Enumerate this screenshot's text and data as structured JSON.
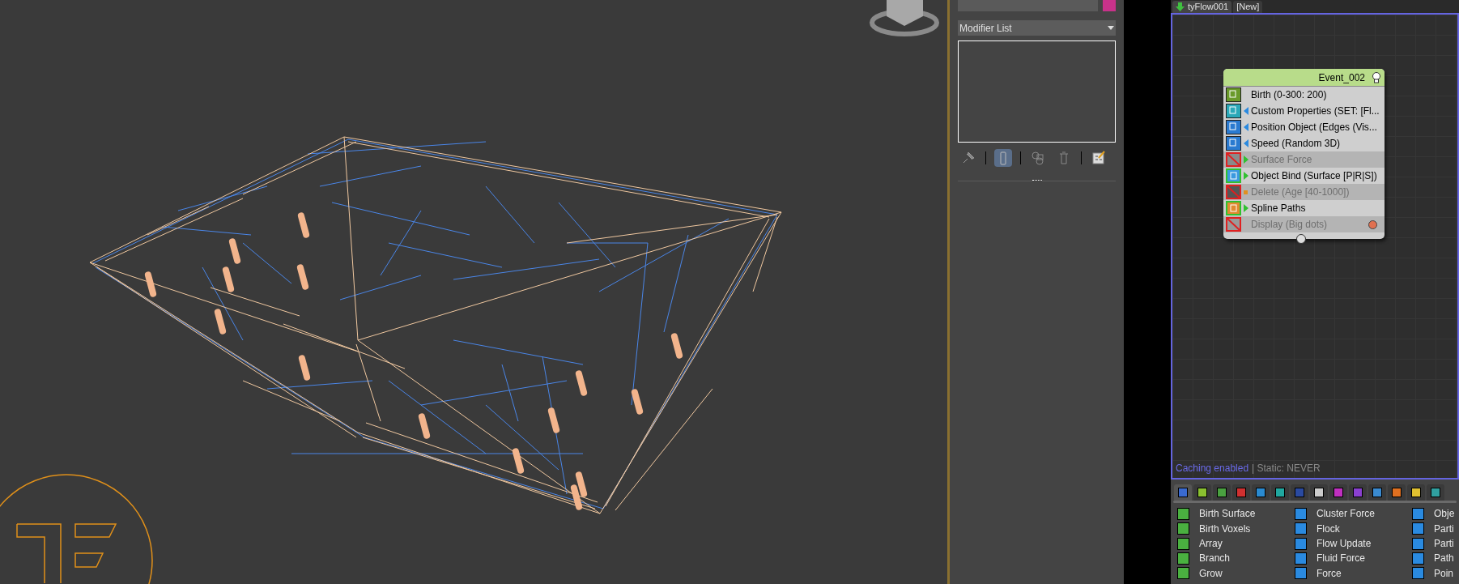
{
  "modifier_panel": {
    "dropdown": "Modifier List",
    "toolbar": [
      {
        "kind": "pin",
        "selected": false
      },
      {
        "kind": "end-result",
        "selected": true
      },
      {
        "kind": "unique",
        "selected": false
      },
      {
        "kind": "delete",
        "selected": false
      },
      {
        "kind": "configure",
        "selected": false
      }
    ]
  },
  "flow_editor": {
    "tabs": [
      {
        "label": "tyFlow001",
        "selected": true
      },
      {
        "label": "[New]",
        "selected": false
      }
    ],
    "event": {
      "title": "Event_002",
      "operators": [
        {
          "label": "Birth (0-300: 200)",
          "kind": "birth",
          "enabled": true,
          "color": "#6a9a2a"
        },
        {
          "label": "Custom Properties (SET: [Fl...",
          "kind": "operator",
          "enabled": true,
          "color": "#2aa8b8"
        },
        {
          "label": "Position Object (Edges (Vis...",
          "kind": "operator",
          "enabled": true,
          "color": "#2a7ad0"
        },
        {
          "label": "Speed (Random 3D)",
          "kind": "operator",
          "enabled": true,
          "color": "#2a7ad0"
        },
        {
          "label": "Surface Force",
          "kind": "test",
          "enabled": false,
          "color": "#8a8a8a"
        },
        {
          "label": "Object Bind (Surface [P|R|S])",
          "kind": "test",
          "enabled": true,
          "color": "#3a9ae0"
        },
        {
          "label": "Delete (Age [40-1000])",
          "kind": "delete",
          "enabled": false,
          "color": "#555555"
        },
        {
          "label": "Spline Paths",
          "kind": "test",
          "enabled": true,
          "color": "#e08a30"
        },
        {
          "label": "Display (Big dots)",
          "kind": "display",
          "enabled": false,
          "color": "#9a9a9a"
        }
      ]
    },
    "status": {
      "caching": "Caching enabled",
      "static": "| Static: NEVER"
    }
  },
  "palette": {
    "tabs": [
      {
        "color": "#3a6ad0",
        "selected": true
      },
      {
        "color": "#8ac030",
        "selected": false
      },
      {
        "color": "#4aa040",
        "selected": false
      },
      {
        "color": "#d03030",
        "selected": false
      },
      {
        "color": "#2a8ad0",
        "selected": false
      },
      {
        "color": "#20a8a0",
        "selected": false
      },
      {
        "color": "#2a4aa0",
        "selected": false
      },
      {
        "color": "#cccccc",
        "selected": false
      },
      {
        "color": "#c030c0",
        "selected": false
      },
      {
        "color": "#8a40d0",
        "selected": false
      },
      {
        "color": "#3a8ad0",
        "selected": false
      },
      {
        "color": "#e07020",
        "selected": false
      },
      {
        "color": "#e0c030",
        "selected": false
      },
      {
        "color": "#30a0a0",
        "selected": false
      }
    ],
    "columns": [
      {
        "color": "#4ab040",
        "items": [
          "Birth Surface",
          "Birth Voxels",
          "Array",
          "Branch",
          "Grow"
        ]
      },
      {
        "color": "#2a8ae0",
        "items": [
          "Cluster Force",
          "Flock",
          "Flow Update",
          "Fluid Force",
          "Force"
        ]
      },
      {
        "color": "#2a8ae0",
        "items": [
          "Obje",
          "Parti",
          "Parti",
          "Path",
          "Poin"
        ]
      }
    ]
  }
}
